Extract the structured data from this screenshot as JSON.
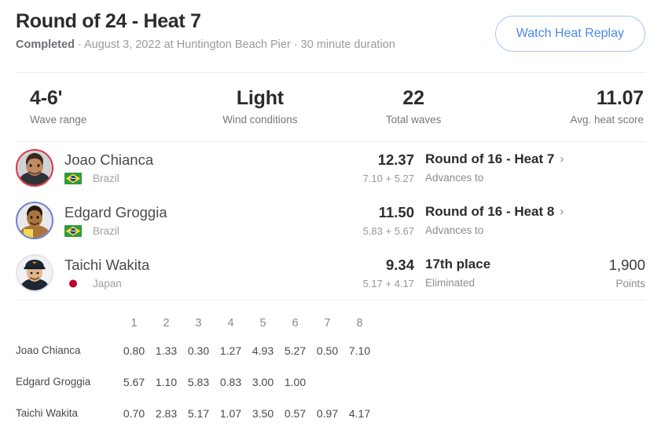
{
  "header": {
    "title": "Round of 24 - Heat 7",
    "status": "Completed",
    "sub_rest": " · August 3, 2022 at Huntington Beach Pier · 30 minute duration",
    "replay_button": "Watch Heat Replay"
  },
  "stats": [
    {
      "value": "4-6'",
      "label": "Wave range"
    },
    {
      "value": "Light",
      "label": "Wind conditions"
    },
    {
      "value": "22",
      "label": "Total waves"
    },
    {
      "value": "11.07",
      "label": "Avg. heat score"
    }
  ],
  "athletes": [
    {
      "name": "Joao Chianca",
      "country": "Brazil",
      "flag": "brazil-flag-icon",
      "ring_color": "#e0343f",
      "total": "12.37",
      "parts": "7.10 + 5.27",
      "result_title": "Round of 16 - Heat 7",
      "result_sub": "Advances to",
      "chevron": "›",
      "points": "",
      "points_label": ""
    },
    {
      "name": "Edgard Groggia",
      "country": "Brazil",
      "flag": "brazil-flag-icon",
      "ring_color": "#6f7ed4",
      "total": "11.50",
      "parts": "5.83 + 5.67",
      "result_title": "Round of 16 - Heat 8",
      "result_sub": "Advances to",
      "chevron": "›",
      "points": "",
      "points_label": ""
    },
    {
      "name": "Taichi Wakita",
      "country": "Japan",
      "flag": "japan-flag-icon",
      "ring_color": "#e4e4e8",
      "total": "9.34",
      "parts": "5.17 + 4.17",
      "result_title": "17th place",
      "result_sub": "Eliminated",
      "chevron": "",
      "points": "1,900",
      "points_label": "Points"
    }
  ],
  "wave_table": {
    "columns": [
      "1",
      "2",
      "3",
      "4",
      "5",
      "6",
      "7",
      "8"
    ],
    "rows": [
      {
        "name": "Joao Chianca",
        "scores": [
          "0.80",
          "1.33",
          "0.30",
          "1.27",
          "4.93",
          "5.27",
          "0.50",
          "7.10"
        ],
        "best": [
          5,
          7
        ]
      },
      {
        "name": "Edgard Groggia",
        "scores": [
          "5.67",
          "1.10",
          "5.83",
          "0.83",
          "3.00",
          "1.00",
          "",
          ""
        ],
        "best": [
          0,
          2
        ]
      },
      {
        "name": "Taichi Wakita",
        "scores": [
          "0.70",
          "2.83",
          "5.17",
          "1.07",
          "3.50",
          "0.57",
          "0.97",
          "4.17"
        ],
        "best": [
          2,
          7
        ]
      }
    ]
  },
  "colors": {
    "accent_blue": "#4a86f0",
    "best_wave_orange": "#f0a12e",
    "divider": "#ececee"
  }
}
